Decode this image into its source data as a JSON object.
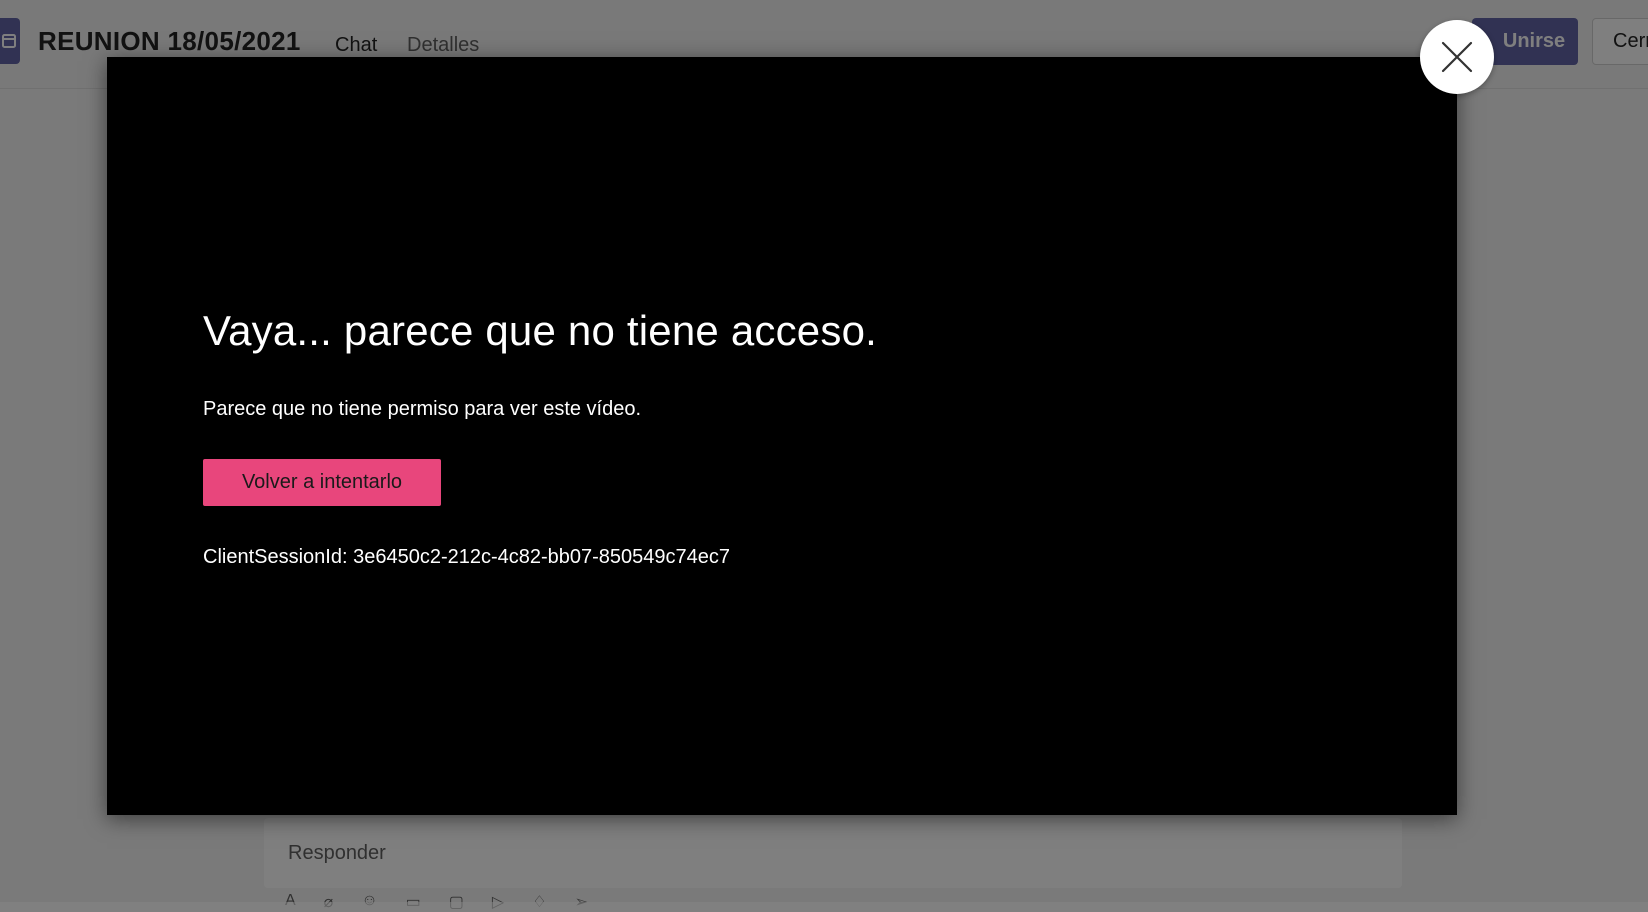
{
  "header": {
    "meeting_title": "REUNION 18/05/2021",
    "tabs": [
      {
        "label": "Chat"
      },
      {
        "label": "Detalles"
      }
    ],
    "join_label": "Unirse",
    "close_label": "Cerr"
  },
  "compose": {
    "reply_placeholder": "Responder"
  },
  "video_error": {
    "title": "Vaya... parece que no tiene acceso.",
    "message": "Parece que no tiene permiso para ver este vídeo.",
    "retry_label": "Volver a intentarlo",
    "session_id": "ClientSessionId: 3e6450c2-212c-4c82-bb07-850549c74ec7"
  },
  "icons": {
    "close": "close-icon",
    "meeting": "calendar-icon"
  },
  "colors": {
    "accent": "#6264a7",
    "retry_button": "#e8467c",
    "modal_background": "#000000"
  }
}
